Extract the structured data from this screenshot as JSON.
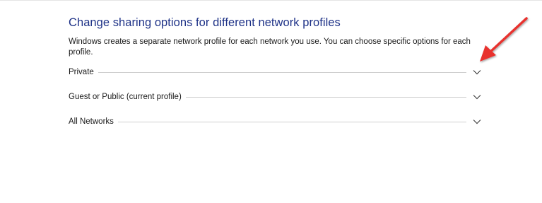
{
  "section": {
    "heading": "Change sharing options for different network profiles",
    "description": "Windows creates a separate network profile for each network you use. You can choose specific options for each profile."
  },
  "profiles": [
    {
      "label": "Private",
      "expanded": false,
      "icon": "chevron-down-icon"
    },
    {
      "label": "Guest or Public (current profile)",
      "expanded": false,
      "icon": "chevron-down-icon"
    },
    {
      "label": "All Networks",
      "expanded": false,
      "icon": "chevron-down-icon"
    }
  ],
  "colors": {
    "heading": "#1e3287",
    "text": "#1a1a1a",
    "divider": "#cfcfcf",
    "annotation_arrow": "#e8322f"
  },
  "annotation": {
    "type": "arrow",
    "points_to": "Private chevron"
  }
}
